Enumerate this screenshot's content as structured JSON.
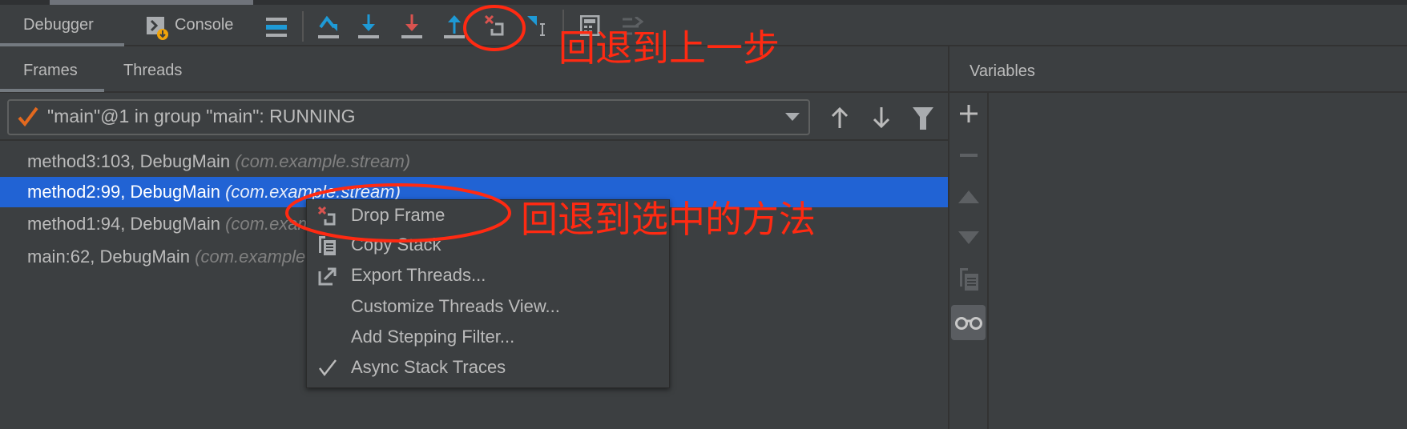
{
  "toolbar": {
    "tabs": [
      {
        "label": "Debugger",
        "active": true
      },
      {
        "label": "Console",
        "active": false
      }
    ],
    "icons": [
      "console-icon",
      "frames-layout-icon",
      "step-over-icon",
      "step-into-icon",
      "force-step-into-icon",
      "step-out-icon",
      "drop-frame-icon",
      "run-to-cursor-icon",
      "evaluate-expression-icon",
      "trace-icon"
    ]
  },
  "frames_panel": {
    "tabs": [
      {
        "label": "Frames",
        "active": true
      },
      {
        "label": "Threads",
        "active": false
      }
    ],
    "thread_selector": {
      "value": "\"main\"@1 in group \"main\": RUNNING"
    },
    "frames": [
      {
        "method": "method3:103, DebugMain",
        "package": "(com.example.stream)",
        "selected": false
      },
      {
        "method": "method2:99, DebugMain",
        "package": "(com.example.stream)",
        "selected": true
      },
      {
        "method": "method1:94, DebugMain",
        "package": "(com.example.stream)",
        "selected": false
      },
      {
        "method": "main:62, DebugMain",
        "package": "(com.example.stream)",
        "selected": false
      }
    ]
  },
  "variables_panel": {
    "title": "Variables"
  },
  "context_menu": {
    "items": [
      {
        "label": "Drop Frame",
        "icon": "drop-frame-icon"
      },
      {
        "label": "Copy Stack",
        "icon": "copy-icon"
      },
      {
        "label": "Export Threads...",
        "icon": "export-icon"
      },
      {
        "label": "Customize Threads View..."
      },
      {
        "label": "Add Stepping Filter..."
      },
      {
        "label": "Async Stack Traces",
        "checked": true
      }
    ]
  },
  "annotations": {
    "toolbar_note": "回退到上一步",
    "menu_note": "回退到选中的方法",
    "color": "#ff2a12"
  },
  "colors": {
    "selection": "#2163d4",
    "background": "#3c3f41",
    "step_blue": "#1e9ad6",
    "step_red": "#d9534f"
  }
}
